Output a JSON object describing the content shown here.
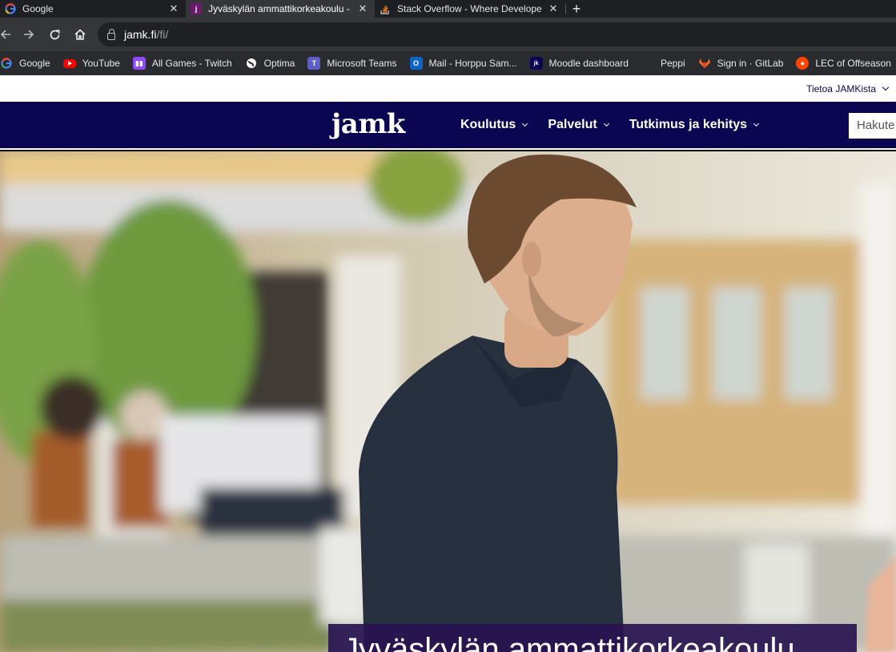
{
  "tabs": [
    {
      "title": "Google",
      "icon": "google-icon"
    },
    {
      "title": "Jyväskylän ammattikorkeakoulu -",
      "icon": "jamk-icon",
      "active": true
    },
    {
      "title": "Stack Overflow - Where Develope",
      "icon": "stackoverflow-icon"
    }
  ],
  "tab_close": "✕",
  "new_tab": "+",
  "address": {
    "domain": "jamk.fi",
    "path": "/fi/"
  },
  "bookmarks": [
    {
      "label": "Google",
      "icon": "google-icon"
    },
    {
      "label": "YouTube",
      "icon": "youtube-icon"
    },
    {
      "label": "All Games - Twitch",
      "icon": "twitch-icon"
    },
    {
      "label": "Optima",
      "icon": "globe-icon"
    },
    {
      "label": "Microsoft Teams",
      "icon": "teams-icon"
    },
    {
      "label": "Mail - Horppu Sam...",
      "icon": "outlook-icon"
    },
    {
      "label": "Moodle dashboard",
      "icon": "jamk-icon"
    },
    {
      "label": "Peppi",
      "icon": ""
    },
    {
      "label": "Sign in · GitLab",
      "icon": "gitlab-icon"
    },
    {
      "label": "LEC of Offseason",
      "icon": "reddit-icon"
    }
  ],
  "site": {
    "about_label": "Tietoa JAMKista",
    "logo_text": "jamk",
    "menu": [
      {
        "label": "Koulutus"
      },
      {
        "label": "Palvelut"
      },
      {
        "label": "Tutkimus ja kehitys"
      }
    ],
    "search_placeholder": "Hakute",
    "hero_title": "Jyväskylän ammattikorkeakoulu"
  },
  "colors": {
    "brand_navy": "#0b0651",
    "chrome_dark": "#35363a"
  }
}
